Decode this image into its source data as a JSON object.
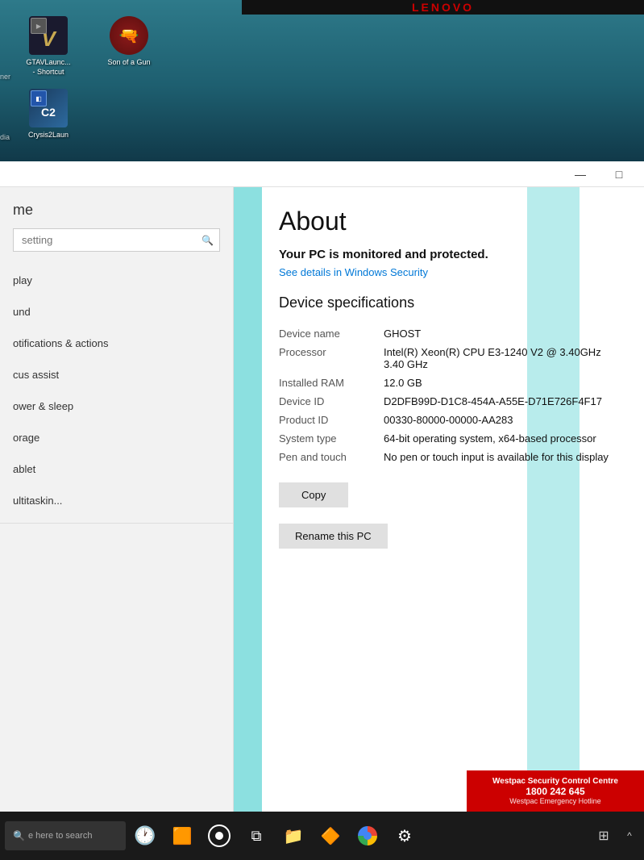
{
  "lenovo": {
    "brand": "lenovo"
  },
  "desktop": {
    "icons": [
      {
        "id": "gtav",
        "label": "GTAVLaunc...\n- Shortcut",
        "label_line1": "GTAVLaunc...",
        "label_line2": "- Shortcut",
        "color_bg": "#1a1a2e",
        "color_text": "#c8a951",
        "symbol": "V"
      },
      {
        "id": "sonofagun",
        "label": "Son of a Gun",
        "label_line1": "Son of a Gun",
        "label_line2": "",
        "color_bg": "#8b1a1a",
        "symbol": "🎯"
      },
      {
        "id": "crysis2",
        "label": "Crysis2Laun",
        "label_line1": "Crysis2Laun",
        "label_line2": "",
        "color_bg": "#1a3a5c",
        "symbol": "C2"
      }
    ]
  },
  "settings_window": {
    "title": "me",
    "search_placeholder": "setting",
    "sidebar_items": [
      {
        "id": "display",
        "label": "play"
      },
      {
        "id": "sound",
        "label": "und"
      },
      {
        "id": "notifications",
        "label": "otifications & actions"
      },
      {
        "id": "focus_assist",
        "label": "cus assist"
      },
      {
        "id": "power_sleep",
        "label": "ower & sleep"
      },
      {
        "id": "storage",
        "label": "orage"
      },
      {
        "id": "tablet",
        "label": "ablet"
      },
      {
        "id": "multitasking",
        "label": "ultitaskin..."
      }
    ]
  },
  "about": {
    "title": "About",
    "protection": "Your PC is monitored and protected.",
    "see_details": "See details in Windows Security",
    "device_specs_title": "Device specifications",
    "specs": [
      {
        "label": "Device name",
        "value": "GHOST"
      },
      {
        "label": "Processor",
        "value": "Intel(R) Xeon(R) CPU E3-1240 V2 @ 3.40GHz  3.40 GHz"
      },
      {
        "label": "Installed RAM",
        "value": "12.0 GB"
      },
      {
        "label": "Device ID",
        "value": "D2DFB99D-D1C8-454A-A55E-D71E726F4F17"
      },
      {
        "label": "Product ID",
        "value": "00330-80000-00000-AA283"
      },
      {
        "label": "System type",
        "value": "64-bit operating system, x64-based processor"
      },
      {
        "label": "Pen and touch",
        "value": "No pen or touch input is available for this display"
      }
    ],
    "copy_button": "Copy",
    "rename_button": "Rename this PC"
  },
  "taskbar": {
    "search_placeholder": "e here to search",
    "icons": [
      {
        "id": "start",
        "symbol": "⊞",
        "color": "#0078d7"
      },
      {
        "id": "search",
        "symbol": "🔍",
        "color": "#fff"
      },
      {
        "id": "taskview",
        "symbol": "⧉",
        "color": "#fff"
      },
      {
        "id": "explorer",
        "symbol": "📁",
        "color": "#ffd700"
      },
      {
        "id": "vlc",
        "symbol": "🔶",
        "color": "#ff8c00"
      },
      {
        "id": "chrome",
        "symbol": "⬤",
        "color": "#4285f4"
      },
      {
        "id": "settings",
        "symbol": "⚙",
        "color": "#fff"
      }
    ],
    "systray": [
      {
        "id": "grid",
        "symbol": "⊞"
      },
      {
        "id": "chevron",
        "symbol": "^"
      },
      {
        "id": "clock_icon",
        "symbol": "🕐"
      }
    ]
  },
  "westpac": {
    "line1": "Westpac Security Control Centre",
    "line2": "1800 242 645",
    "line3": "Westpac Emergency Hotline"
  },
  "window_controls": {
    "minimize": "—",
    "maximize": "□"
  }
}
